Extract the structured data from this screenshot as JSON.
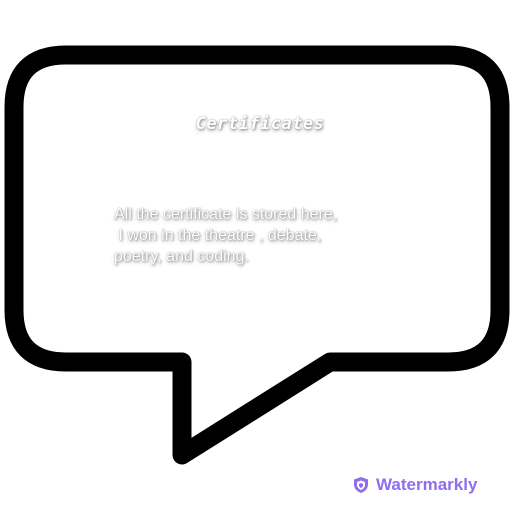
{
  "card": {
    "title": "Certificates",
    "description_lines": [
      "All the certificate is stored here,",
      " I won in the theatre , debate,",
      "poetry, and coding."
    ]
  },
  "watermark": {
    "label": "Watermarkly",
    "icon": "shield-icon",
    "color": "#8f6cf0"
  },
  "colors": {
    "outline": "#000000",
    "fill": "#ffffff"
  }
}
